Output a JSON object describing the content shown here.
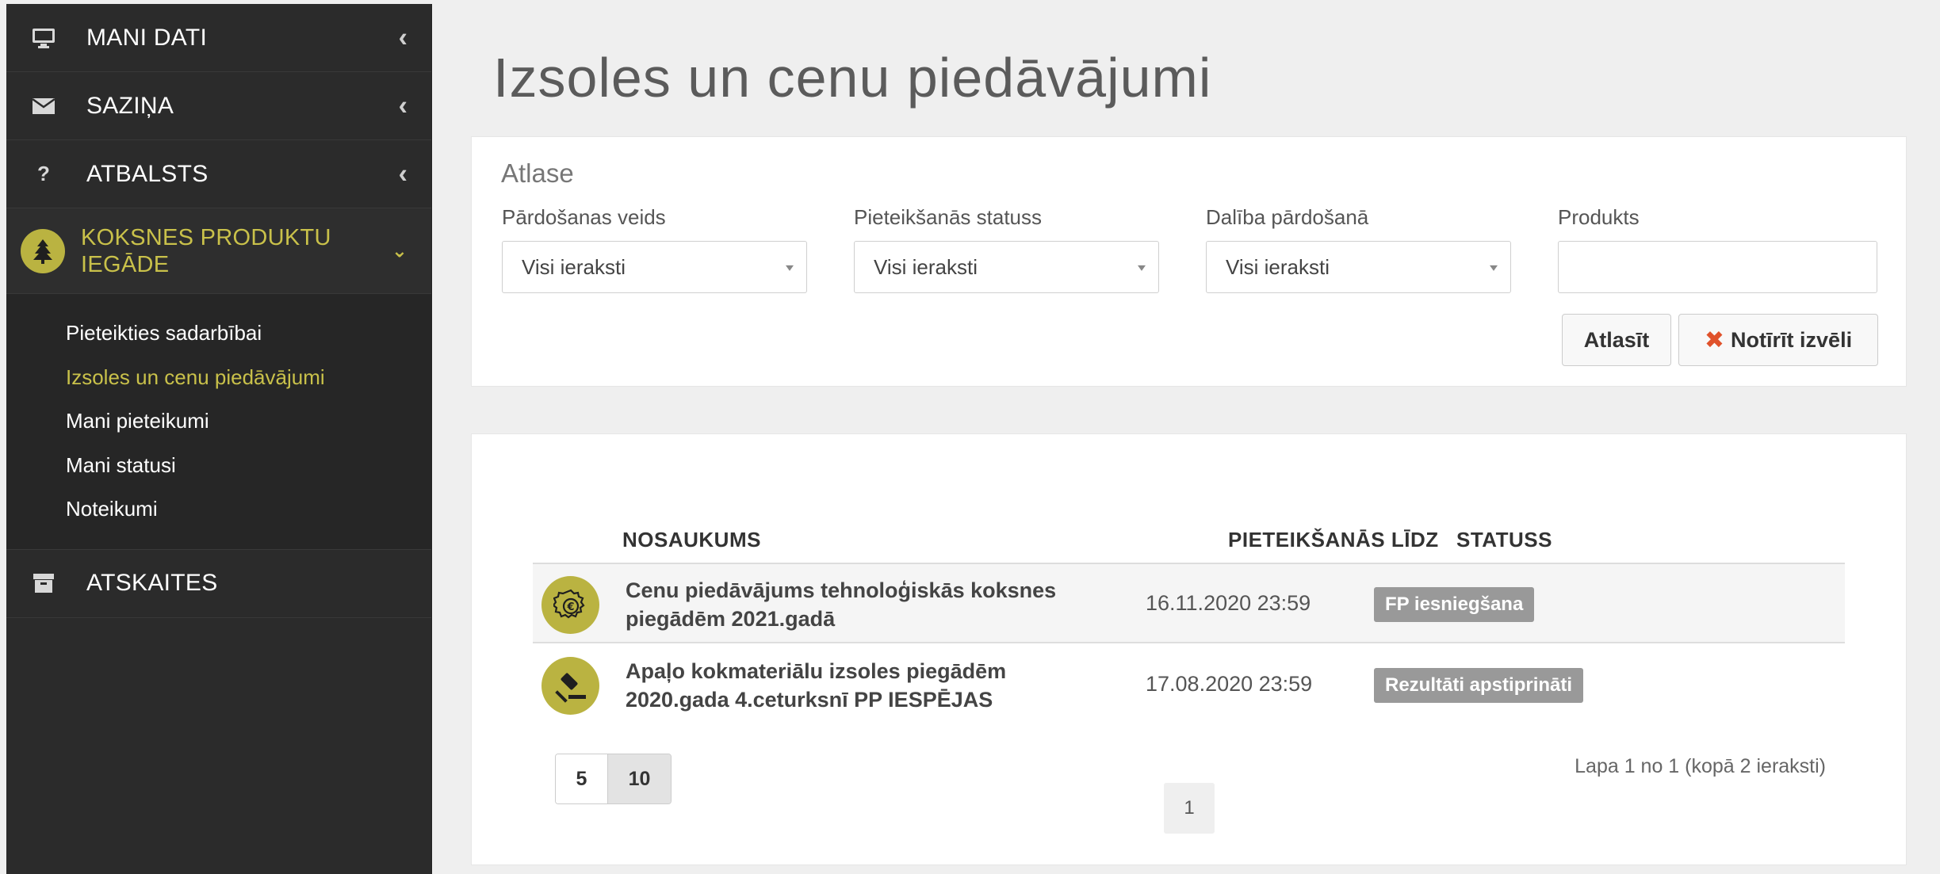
{
  "sidebar": {
    "items": [
      {
        "label": "MANI DATI",
        "icon": "monitor-icon"
      },
      {
        "label": "SAZIŅA",
        "icon": "envelope-icon"
      },
      {
        "label": "ATBALSTS",
        "icon": "question-icon"
      },
      {
        "label": "KOKSNES PRODUKTU IEGĀDE",
        "icon": "tree-icon"
      },
      {
        "label": "ATSKAITES",
        "icon": "archive-icon"
      }
    ],
    "subitems": [
      {
        "label": "Pieteikties sadarbībai"
      },
      {
        "label": "Izsoles un cenu piedāvājumi"
      },
      {
        "label": "Mani pieteikumi"
      },
      {
        "label": "Mani statusi"
      },
      {
        "label": "Noteikumi"
      }
    ]
  },
  "page": {
    "title": "Izsoles un cenu piedāvājumi"
  },
  "filters": {
    "title": "Atlase",
    "sale_type": {
      "label": "Pārdošanas veids",
      "value": "Visi ieraksti"
    },
    "application_status": {
      "label": "Pieteikšanās statuss",
      "value": "Visi ieraksti"
    },
    "participation": {
      "label": "Dalība pārdošanā",
      "value": "Visi ieraksti"
    },
    "product": {
      "label": "Produkts",
      "value": ""
    },
    "search_button": "Atlasīt",
    "clear_button": "Notīrīt izvēli",
    "clear_icon": "✖"
  },
  "table": {
    "columns": {
      "name": "NOSAUKUMS",
      "deadline": "PIETEIKŠANĀS LĪDZ",
      "status": "STATUSS"
    },
    "rows": [
      {
        "icon": "price-offer-icon",
        "name": "Cenu piedāvājums tehnoloģiskās koksnes piegādēm 2021.gadā",
        "deadline": "16.11.2020 23:59",
        "status": "FP iesniegšana"
      },
      {
        "icon": "auction-gavel-icon",
        "name": "Apaļo kokmateriālu izsoles piegādēm 2020.gada 4.ceturksnī PP IESPĒJAS",
        "deadline": "17.08.2020 23:59",
        "status": "Rezultāti apstiprināti"
      }
    ]
  },
  "pagination": {
    "page_sizes": [
      "5",
      "10"
    ],
    "selected_page_size": "10",
    "info": "Lapa 1 no 1 (kopā 2 ieraksti)",
    "current_page": "1"
  },
  "colors": {
    "accent": "#c9c14a",
    "badge_bg": "#bab341",
    "sidebar_bg": "#2b2b2b",
    "status_badge": "#999999",
    "clear_icon": "#e0522b"
  }
}
